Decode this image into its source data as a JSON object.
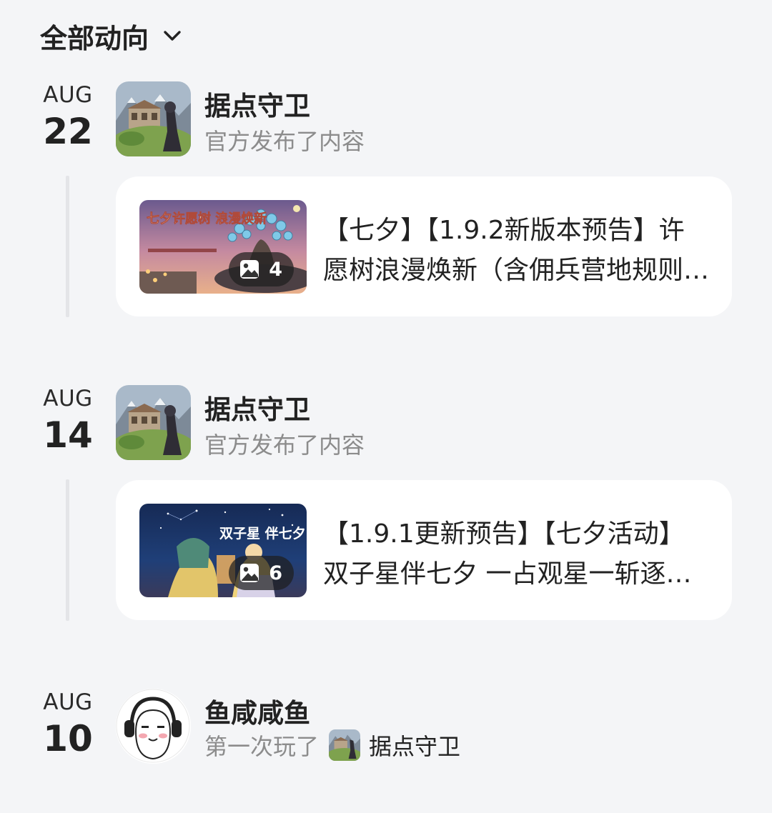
{
  "filter": {
    "label": "全部动向"
  },
  "feed": [
    {
      "date": {
        "month": "AUG",
        "day": "22"
      },
      "user_name": "据点守卫",
      "action": "官方发布了内容",
      "post": {
        "title": "【七夕】【1.9.2新版本预告】许愿树浪漫焕新（含佣兵营地规则…",
        "image_count": "4",
        "thumb_text": "七夕许愿树 浪漫焕新"
      }
    },
    {
      "date": {
        "month": "AUG",
        "day": "14"
      },
      "user_name": "据点守卫",
      "action": "官方发布了内容",
      "post": {
        "title": "【1.9.1更新预告】【七夕活动】双子星伴七夕 一占观星一斩逐…",
        "image_count": "6",
        "thumb_text": "双子星 伴七夕"
      }
    },
    {
      "date": {
        "month": "AUG",
        "day": "10"
      },
      "user_name": "鱼咸咸鱼",
      "action": "第一次玩了",
      "game_name": "据点守卫"
    }
  ],
  "icons": {
    "filter_toggle": "chevron-down-icon",
    "image_badge": "image-icon"
  }
}
